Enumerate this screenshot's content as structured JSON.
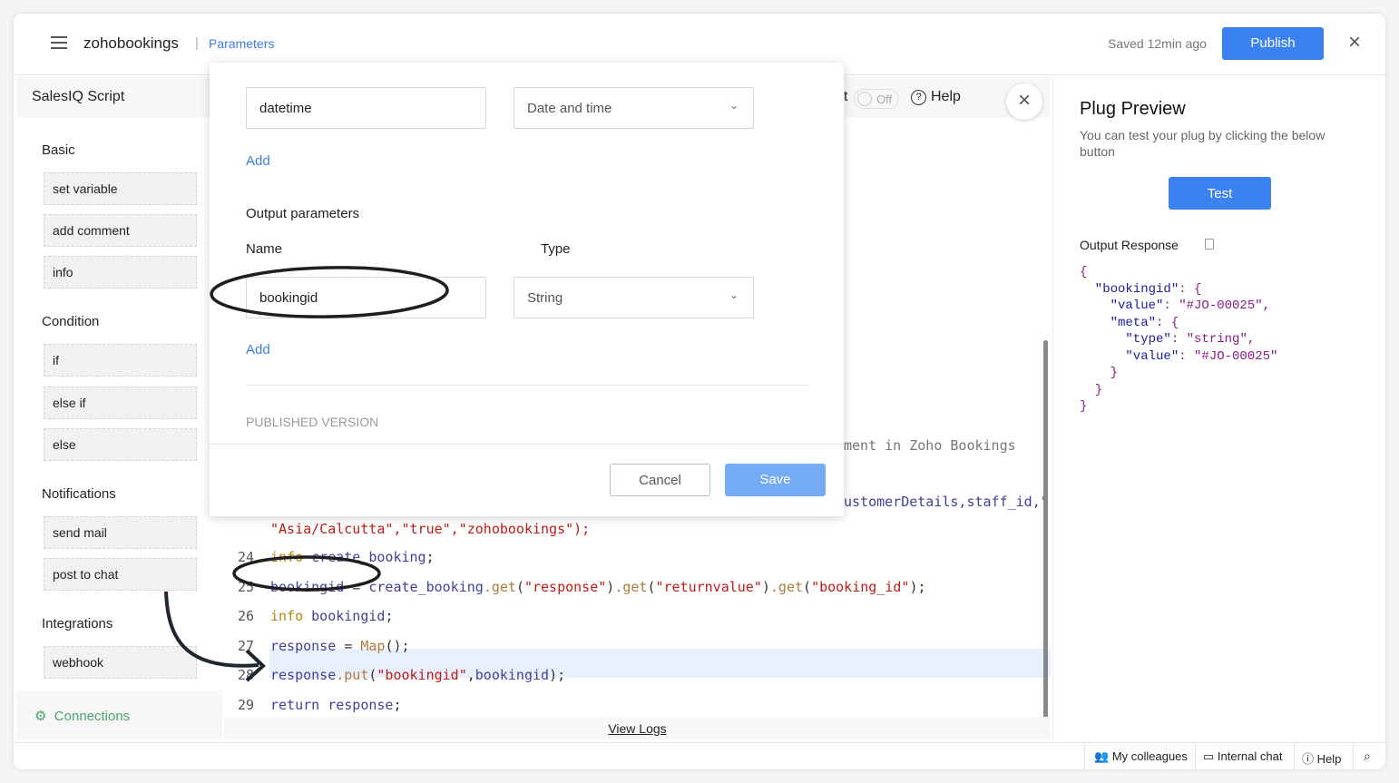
{
  "header": {
    "app_name": "zohobookings",
    "separator": "|",
    "breadcrumb": "Parameters",
    "saved_status": "Saved 12min ago",
    "publish_label": "Publish"
  },
  "sidebar": {
    "title": "SalesIQ Script",
    "sections": [
      {
        "title": "Basic",
        "items": [
          "set variable",
          "add comment",
          "info"
        ]
      },
      {
        "title": "Condition",
        "items": [
          "if",
          "else if",
          "else"
        ]
      },
      {
        "title": "Notifications",
        "items": [
          "send mail",
          "post to chat"
        ]
      },
      {
        "title": "Integrations",
        "items": [
          "webhook"
        ]
      }
    ],
    "connections_label": "Connections"
  },
  "editor": {
    "toggle_prefix": "t",
    "toggle_state": "Off",
    "help_label": "Help",
    "view_logs": "View Logs",
    "partial_comment": "ment in Zoho Bookings",
    "partial_line": "ustomerDetails,staff_id,\"",
    "partial_line23": "\"Asia/Calcutta\",\"true\",\"zohobookings\");",
    "lines": [
      {
        "n": "24",
        "parts": [
          [
            "kw",
            "info "
          ],
          [
            "id",
            "create_booking"
          ],
          [
            "pl",
            ";"
          ]
        ]
      },
      {
        "n": "25",
        "parts": [
          [
            "id",
            "bookingid"
          ],
          [
            "pl",
            " = "
          ],
          [
            "id",
            "create_booking"
          ],
          [
            "fn",
            ".get"
          ],
          [
            "pl",
            "("
          ],
          [
            "st",
            "\"response\""
          ],
          [
            "pl",
            ")"
          ],
          [
            "fn",
            ".get"
          ],
          [
            "pl",
            "("
          ],
          [
            "st",
            "\"returnvalue\""
          ],
          [
            "pl",
            ")"
          ],
          [
            "fn",
            ".get"
          ],
          [
            "pl",
            "("
          ],
          [
            "st",
            "\"booking_id\""
          ],
          [
            "pl",
            ");"
          ]
        ]
      },
      {
        "n": "26",
        "parts": [
          [
            "kw",
            "info "
          ],
          [
            "id",
            "bookingid"
          ],
          [
            "pl",
            ";"
          ]
        ]
      },
      {
        "n": "27",
        "parts": [
          [
            "id",
            "response"
          ],
          [
            "pl",
            " = "
          ],
          [
            "fn",
            "Map"
          ],
          [
            "pl",
            "();"
          ]
        ]
      },
      {
        "n": "28",
        "parts": [
          [
            "id",
            "response"
          ],
          [
            "fn",
            ".put"
          ],
          [
            "pl",
            "("
          ],
          [
            "st",
            "\"bookingid\""
          ],
          [
            "pl",
            ","
          ],
          [
            "id",
            "bookingid"
          ],
          [
            "pl",
            ");"
          ]
        ]
      },
      {
        "n": "29",
        "parts": [
          [
            "id",
            "return response"
          ],
          [
            "pl",
            ";"
          ]
        ]
      }
    ]
  },
  "modal": {
    "input_name_value": "datetime",
    "input_type_value": "Date and time",
    "add_label_1": "Add",
    "output_title": "Output parameters",
    "col_name": "Name",
    "col_type": "Type",
    "output_name_value": "bookingid",
    "output_type_value": "String",
    "add_label_2": "Add",
    "published_version": "PUBLISHED VERSION",
    "cancel_label": "Cancel",
    "save_label": "Save"
  },
  "preview": {
    "title": "Plug Preview",
    "description": "You can test your plug by clicking the below button",
    "test_label": "Test",
    "output_label": "Output Response",
    "json_lines": [
      [
        "",
        "{"
      ],
      [
        "k",
        "  \"bookingid\"",
        ": {"
      ],
      [
        "k",
        "    \"value\"",
        ": \"#JO-00025\","
      ],
      [
        "k",
        "    \"meta\"",
        ": {"
      ],
      [
        "k",
        "      \"type\"",
        ": \"string\","
      ],
      [
        "k",
        "      \"value\"",
        ": \"#JO-00025\""
      ],
      [
        "",
        "    }"
      ],
      [
        "",
        "  }"
      ],
      [
        "",
        "}"
      ]
    ]
  },
  "footer": {
    "colleagues": "My colleagues",
    "internal_chat": "Internal chat",
    "help": "Help"
  },
  "colors": {
    "accent": "#3b82f0",
    "save_disabled": "#75aaf5",
    "highlight_line": "#e8f0fd"
  }
}
